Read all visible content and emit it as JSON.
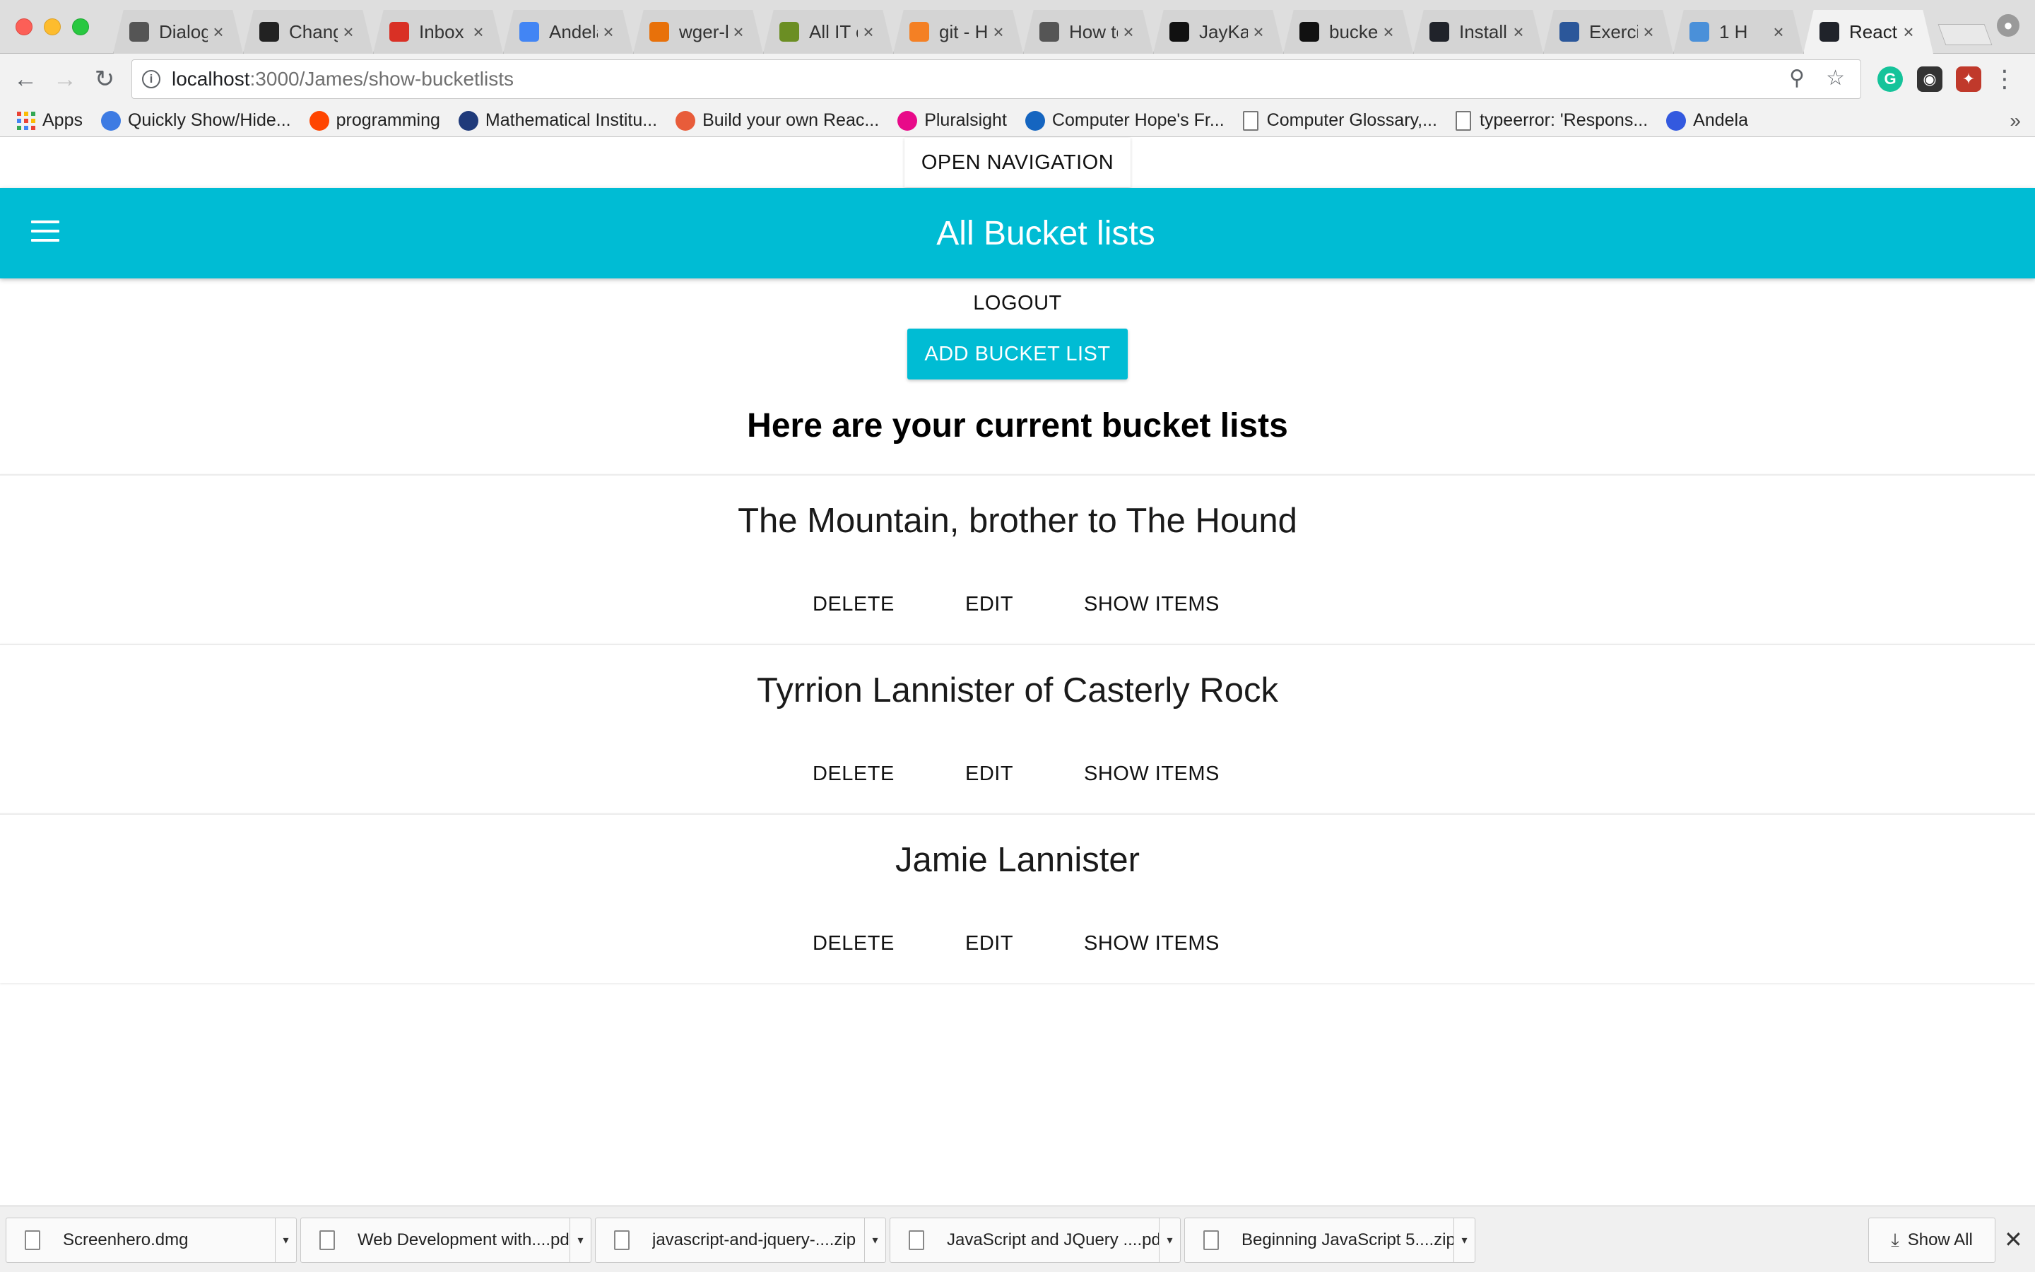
{
  "browser": {
    "tabs": [
      {
        "title": "Dialog",
        "icon": "dialog-favicon",
        "color": "#555555"
      },
      {
        "title": "Chang",
        "icon": "x-favicon",
        "color": "#222222"
      },
      {
        "title": "Inbox (",
        "icon": "gmail-favicon",
        "color": "#d93025"
      },
      {
        "title": "Andela",
        "icon": "calendar-favicon",
        "color": "#4285f4"
      },
      {
        "title": "wger-l",
        "icon": "wger-favicon",
        "color": "#e8710a"
      },
      {
        "title": "All IT e",
        "icon": "books-favicon",
        "color": "#6b8e23"
      },
      {
        "title": "git - H",
        "icon": "stackoverflow-favicon",
        "color": "#f48024"
      },
      {
        "title": "How to",
        "icon": "apple-favicon",
        "color": "#555555"
      },
      {
        "title": "JayKay",
        "icon": "github-favicon",
        "color": "#111111"
      },
      {
        "title": "bucket",
        "icon": "github-favicon",
        "color": "#111111"
      },
      {
        "title": "Installa",
        "icon": "react-favicon",
        "color": "#20232a"
      },
      {
        "title": "Exercis",
        "icon": "word-favicon",
        "color": "#2b579a"
      },
      {
        "title": "1 H",
        "icon": "play-favicon",
        "color": "#4a90d9"
      },
      {
        "title": "React /",
        "icon": "react-favicon",
        "color": "#20232a"
      }
    ],
    "url_host": "localhost",
    "url_path": ":3000/James/show-bucketlists",
    "bookmarks": [
      {
        "label": "Apps",
        "icon": "apps-grid-icon"
      },
      {
        "label": "Quickly Show/Hide...",
        "icon": "chart-favicon",
        "color": "#3d7be3"
      },
      {
        "label": "programming",
        "icon": "reddit-favicon",
        "color": "#ff4500"
      },
      {
        "label": "Mathematical Institu...",
        "icon": "institute-favicon",
        "color": "#1f3a7a"
      },
      {
        "label": "Build your own Reac...",
        "icon": "build-favicon",
        "color": "#e85c3a"
      },
      {
        "label": "Pluralsight",
        "icon": "pluralsight-favicon",
        "color": "#e80a89"
      },
      {
        "label": "Computer Hope's Fr...",
        "icon": "computerhope-favicon",
        "color": "#1565c0"
      },
      {
        "label": "Computer Glossary,...",
        "icon": "document-icon"
      },
      {
        "label": "typeerror: 'Respons...",
        "icon": "document-icon"
      },
      {
        "label": "Andela",
        "icon": "andela-favicon",
        "color": "#3359df"
      }
    ]
  },
  "app": {
    "open_navigation": "OPEN NAVIGATION",
    "title": "All Bucket lists",
    "logout": "LOGOUT",
    "add_button": "ADD BUCKET LIST",
    "heading": "Here are your current bucket lists",
    "accent_color": "#00bcd4",
    "bucketlists": [
      {
        "name": "The Mountain, brother to The Hound",
        "delete": "DELETE",
        "edit": "EDIT",
        "show": "SHOW ITEMS"
      },
      {
        "name": "Tyrrion Lannister of Casterly Rock",
        "delete": "DELETE",
        "edit": "EDIT",
        "show": "SHOW ITEMS"
      },
      {
        "name": "Jamie Lannister",
        "delete": "DELETE",
        "edit": "EDIT",
        "show": "SHOW ITEMS"
      }
    ]
  },
  "downloads": {
    "items": [
      {
        "name": "Screenhero.dmg"
      },
      {
        "name": "Web Development with....pdf"
      },
      {
        "name": "javascript-and-jquery-....zip"
      },
      {
        "name": "JavaScript and JQuery ....pdf"
      },
      {
        "name": "Beginning JavaScript 5....zip"
      }
    ],
    "show_all": "Show All"
  }
}
